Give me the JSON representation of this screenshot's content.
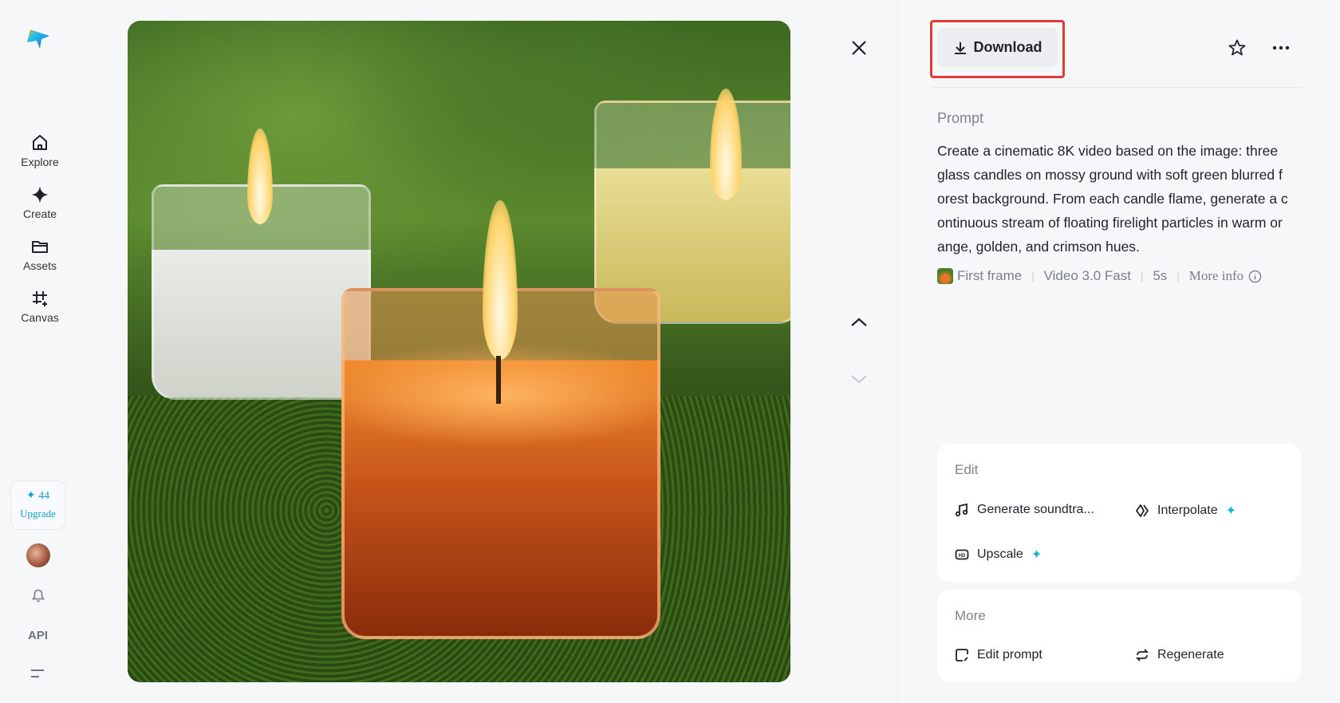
{
  "sidebar": {
    "items": [
      {
        "label": "Explore"
      },
      {
        "label": "Create"
      },
      {
        "label": "Assets"
      },
      {
        "label": "Canvas"
      }
    ],
    "credits": "44",
    "upgrade": "Upgrade",
    "api": "API"
  },
  "toolbar": {
    "download": "Download"
  },
  "prompt": {
    "label": "Prompt",
    "lines": [
      "Create a cinematic 8K video based on the image: three",
      "glass candles on mossy ground with soft green blurred f",
      "orest background. From each candle flame, generate a c",
      "ontinuous stream of floating firelight particles in warm or",
      "ange, golden, and crimson hues."
    ],
    "meta": {
      "mode": "First frame",
      "model": "Video 3.0 Fast",
      "duration": "5s",
      "more": "More info"
    }
  },
  "edit": {
    "title": "Edit",
    "items": [
      "Generate soundtra...",
      "Interpolate",
      "Upscale"
    ]
  },
  "more": {
    "title": "More",
    "items": [
      "Edit prompt",
      "Regenerate"
    ]
  },
  "colors": {
    "accent": "#12b8d0",
    "highlight": "#e53935"
  }
}
